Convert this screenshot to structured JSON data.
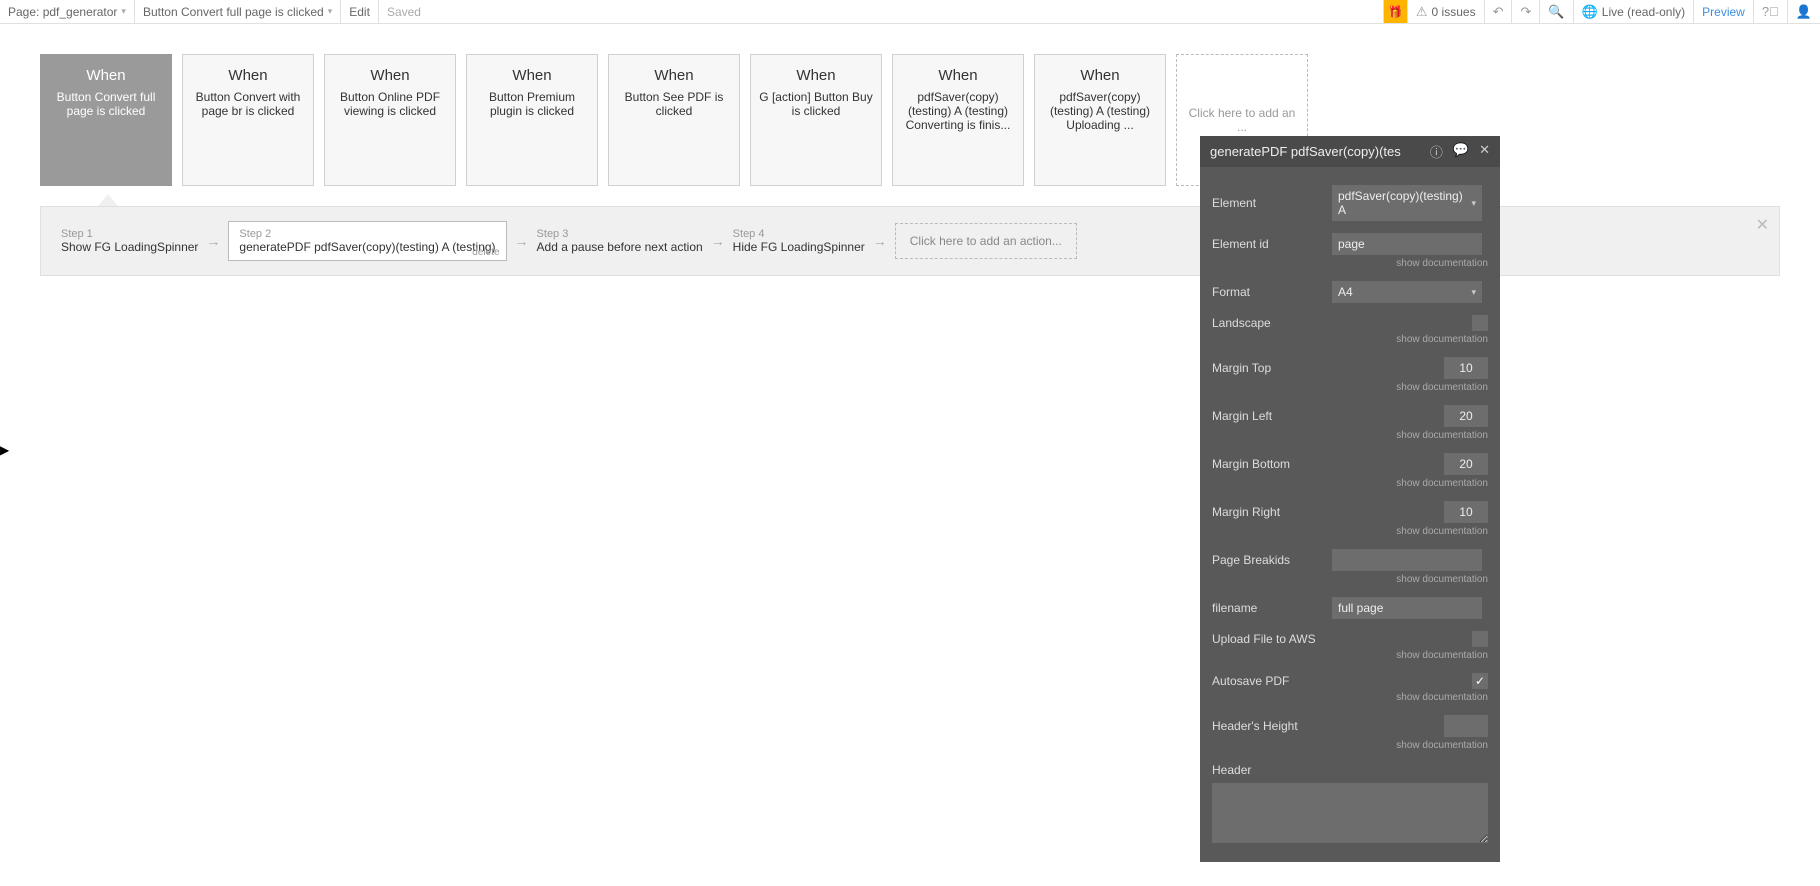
{
  "topbar": {
    "page_label": "Page: pdf_generator",
    "workflow_label": "Button Convert full page is clicked",
    "edit": "Edit",
    "saved": "Saved",
    "issues": "0 issues",
    "live": "Live (read-only)",
    "preview": "Preview"
  },
  "events": [
    {
      "when": "When",
      "desc": "Button Convert full page is clicked",
      "active": true
    },
    {
      "when": "When",
      "desc": "Button Convert with page br is clicked"
    },
    {
      "when": "When",
      "desc": "Button Online PDF viewing is clicked"
    },
    {
      "when": "When",
      "desc": "Button Premium plugin is clicked"
    },
    {
      "when": "When",
      "desc": "Button See PDF is clicked"
    },
    {
      "when": "When",
      "desc": "G [action] Button Buy is clicked"
    },
    {
      "when": "When",
      "desc": "pdfSaver(copy)(testing) A (testing) Converting is finis..."
    },
    {
      "when": "When",
      "desc": "pdfSaver(copy)(testing) A (testing) Uploading ..."
    }
  ],
  "add_event": "Click here to add an ...",
  "steps": [
    {
      "label": "Step 1",
      "text": "Show FG LoadingSpinner"
    },
    {
      "label": "Step 2",
      "text": "generatePDF pdfSaver(copy)(testing) A (testing)",
      "active": true,
      "delete": "delete"
    },
    {
      "label": "Step 3",
      "text": "Add a pause before next action"
    },
    {
      "label": "Step 4",
      "text": "Hide FG LoadingSpinner"
    }
  ],
  "add_action": "Click here to add an action...",
  "panel": {
    "title": "generatePDF pdfSaver(copy)(tes",
    "element_label": "Element",
    "element_value": "pdfSaver(copy)(testing) A",
    "element_id_label": "Element id",
    "element_id_value": "page",
    "format_label": "Format",
    "format_value": "A4",
    "landscape_label": "Landscape",
    "margin_top_label": "Margin Top",
    "margin_top_value": "10",
    "margin_left_label": "Margin Left",
    "margin_left_value": "20",
    "margin_bottom_label": "Margin Bottom",
    "margin_bottom_value": "20",
    "margin_right_label": "Margin Right",
    "margin_right_value": "10",
    "page_break_label": "Page Breakids",
    "filename_label": "filename",
    "filename_value": "full page",
    "upload_label": "Upload File to AWS",
    "autosave_label": "Autosave PDF",
    "header_height_label": "Header's Height",
    "header_label": "Header",
    "doc_link": "show documentation"
  }
}
